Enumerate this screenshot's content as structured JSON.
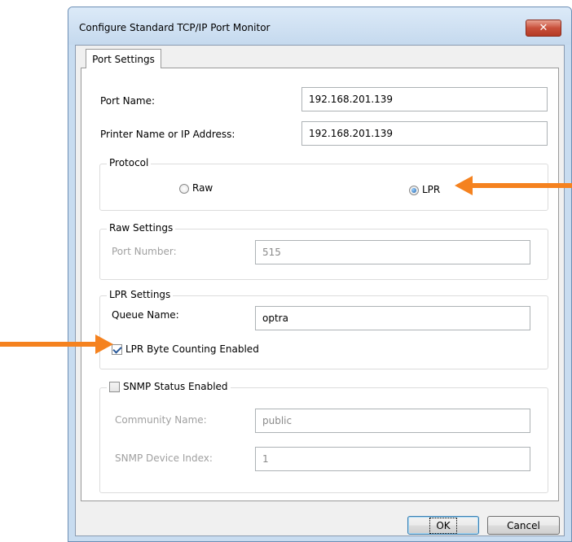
{
  "window": {
    "title": "Configure Standard TCP/IP Port Monitor",
    "close_label": "✕"
  },
  "tabs": [
    {
      "label": "Port Settings"
    }
  ],
  "port_name": {
    "label": "Port Name:",
    "value": "192.168.201.139"
  },
  "printer_address": {
    "label": "Printer Name or IP Address:",
    "value": "192.168.201.139"
  },
  "protocol": {
    "legend": "Protocol",
    "raw_label": "Raw",
    "lpr_label": "LPR",
    "selected": "LPR"
  },
  "raw_settings": {
    "legend": "Raw Settings",
    "port_number_label": "Port Number:",
    "port_number_value": "515"
  },
  "lpr_settings": {
    "legend": "LPR Settings",
    "queue_name_label": "Queue Name:",
    "queue_name_value": "optra",
    "byte_counting_label": "LPR Byte Counting Enabled",
    "byte_counting_checked": true
  },
  "snmp": {
    "legend": "SNMP Status Enabled",
    "checked": false,
    "community_label": "Community Name:",
    "community_value": "public",
    "device_index_label": "SNMP Device Index:",
    "device_index_value": "1"
  },
  "buttons": {
    "ok": "OK",
    "cancel": "Cancel"
  },
  "colors": {
    "annotation_arrow": "#f5821f",
    "title_bar": "#c8dcf0",
    "close_button": "#c8503b"
  }
}
